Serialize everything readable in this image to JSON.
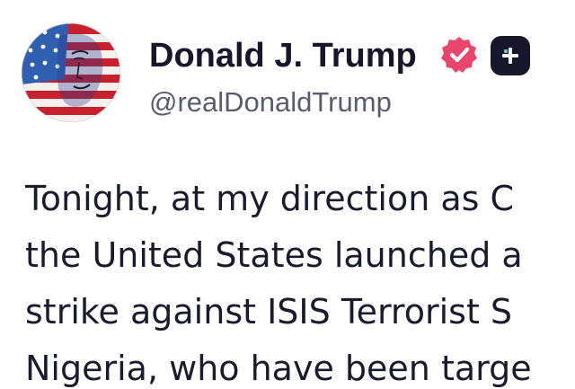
{
  "profile": {
    "display_name": "Donald J. Trump",
    "handle": "@realDonaldTrump",
    "verified": true
  },
  "icons": {
    "verified_badge": "verified-badge-icon",
    "follow": "plus-icon",
    "avatar": "flag-portrait"
  },
  "post": {
    "lines": [
      "Tonight, at my direction as C",
      "the United States launched a",
      "strike against ISIS Terrorist S",
      "Nigeria, who have been targe"
    ]
  },
  "colors": {
    "name_text": "#17162a",
    "handle_text": "#5b5b6e",
    "verified_badge": "#e8466b",
    "follow_button": "#17162a",
    "follow_icon": "#ffffff",
    "body_text": "#1b1b2e"
  }
}
